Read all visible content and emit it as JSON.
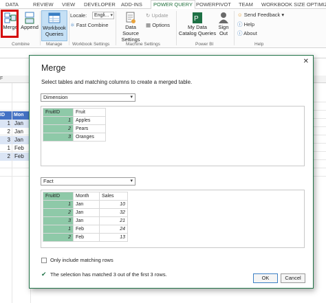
{
  "tabs": [
    "DATA",
    "REVIEW",
    "VIEW",
    "DEVELOPER",
    "ADD-INS",
    "POWER QUERY",
    "POWERPIVOT",
    "TEAM",
    "WORKBOOK SIZE OPTIMIZ"
  ],
  "active_tab": "POWER QUERY",
  "ribbon": {
    "merge": "Merge",
    "append": "Append",
    "workbook_queries_line1": "Workbook",
    "workbook_queries_line2": "Queries",
    "locale_label": "Locale:",
    "locale_value": "Engli...",
    "fast_combine": "Fast Combine",
    "update": "Update",
    "options": "Options",
    "data_source_line1": "Data Source",
    "data_source_line2": "Settings",
    "my_data_line1": "My Data",
    "my_data_line2": "Catalog Queries",
    "sign_out_line1": "Sign",
    "sign_out_line2": "Out",
    "send_feedback": "Send Feedback",
    "help": "Help",
    "about": "About",
    "groups": [
      "Combine",
      "Manage",
      "Workbook Settings",
      "Machine Settings",
      "Power BI",
      "Help"
    ]
  },
  "sheet": {
    "col_f": "F",
    "table_headers": [
      "ID",
      "Mon"
    ],
    "rows": [
      {
        "id": "1",
        "month": "Jan"
      },
      {
        "id": "2",
        "month": "Jan"
      },
      {
        "id": "3",
        "month": "Jan"
      },
      {
        "id": "1",
        "month": "Feb"
      },
      {
        "id": "2",
        "month": "Feb"
      }
    ]
  },
  "dialog": {
    "title": "Merge",
    "close": "✕",
    "subtitle": "Select tables and matching columns to create a merged table.",
    "table1_select": "Dimension",
    "table1_columns": [
      "FruitID",
      "Fruit"
    ],
    "table1_rows": [
      [
        "1",
        "Apples"
      ],
      [
        "2",
        "Pears"
      ],
      [
        "3",
        "Oranges"
      ]
    ],
    "table2_select": "Fact",
    "table2_columns": [
      "FruitID",
      "Month",
      "Sales"
    ],
    "table2_rows": [
      [
        "1",
        "Jan",
        "10"
      ],
      [
        "2",
        "Jan",
        "32"
      ],
      [
        "3",
        "Jan",
        "21"
      ],
      [
        "1",
        "Feb",
        "24"
      ],
      [
        "2",
        "Feb",
        "13"
      ]
    ],
    "only_matching": "Only include matching rows",
    "status": "The selection has matched 3 out of the first 3 rows.",
    "ok": "OK",
    "cancel": "Cancel"
  },
  "colors": {
    "accent": "#1e7145",
    "key_column": "#8ec9a8",
    "table_header": "#4472c4",
    "highlight": "#d40000"
  }
}
